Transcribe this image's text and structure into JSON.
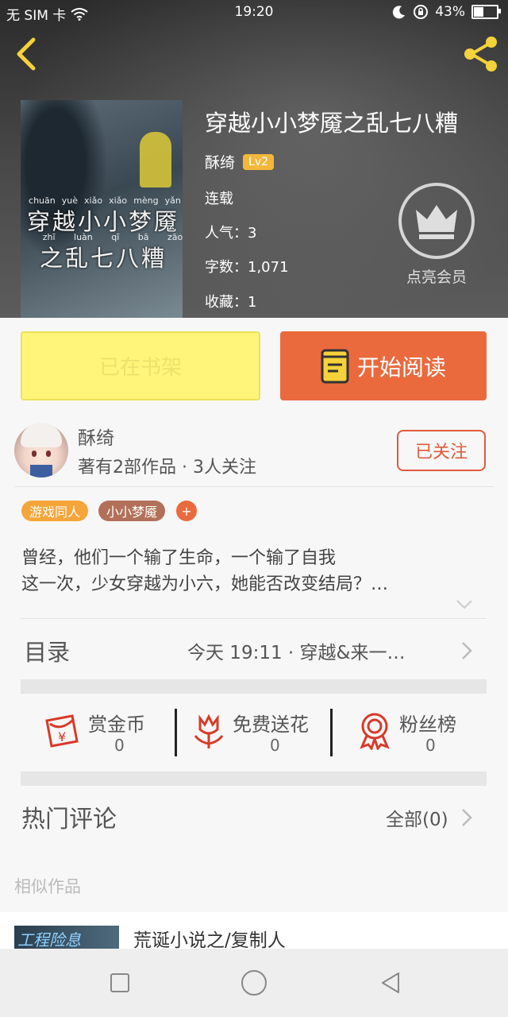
{
  "status_bar": {
    "carrier": "无 SIM 卡",
    "time": "19:20",
    "battery": "43%"
  },
  "book": {
    "title": "穿越小小梦魇之乱七八糟",
    "author": "酥绮",
    "level": "Lv2",
    "status": "连载",
    "popularity": "人气：3",
    "word_count": "字数：1,071",
    "favorites": "收藏：1",
    "cover_pinyin_line1": [
      "chuān",
      "yuè",
      "xiǎo",
      "xiǎo",
      "mèng",
      "yǎn"
    ],
    "cover_title_line1": "穿越小小梦魇",
    "cover_pinyin_line2": [
      "zhī",
      "luàn",
      "qī",
      "bā",
      "zāo"
    ],
    "cover_title_line2": "之乱七八糟"
  },
  "vip": {
    "label": "点亮会员"
  },
  "actions": {
    "shelf_label": "已在书架",
    "read_label": "开始阅读"
  },
  "author_card": {
    "name": "酥绮",
    "stats": "著有2部作品 · 3人关注",
    "follow_label": "已关注"
  },
  "tags": [
    {
      "label": "游戏同人",
      "color": "#f5a53a"
    },
    {
      "label": "小小梦魇",
      "color": "#b2705a"
    },
    {
      "label": "+",
      "color": "#ea6a3e"
    }
  ],
  "description": {
    "line1": "曾经，他们一个输了生命，一个输了自我",
    "line2": "这一次，少女穿越为小六，她能否改变结局？…"
  },
  "toc": {
    "label": "目录",
    "latest": "今天 19:11 · 穿越&来一…"
  },
  "stats": [
    {
      "label": "赏金币",
      "value": "0",
      "icon": "red-envelope-icon"
    },
    {
      "label": "免费送花",
      "value": "0",
      "icon": "flower-icon"
    },
    {
      "label": "粉丝榜",
      "value": "0",
      "icon": "medal-icon"
    }
  ],
  "comments": {
    "label": "热门评论",
    "all_label": "全部(0)"
  },
  "similar": {
    "label": "相似作品",
    "items": [
      {
        "title": "荒诞小说之/复制人",
        "thumb_text": "工程险息"
      }
    ]
  },
  "colors": {
    "accent_orange": "#ea6a3e",
    "shelf_yellow": "#fff57a",
    "level_badge": "#f5b73a",
    "icon_yellow": "#f5d23a",
    "stat_red": "#d83a2a"
  }
}
